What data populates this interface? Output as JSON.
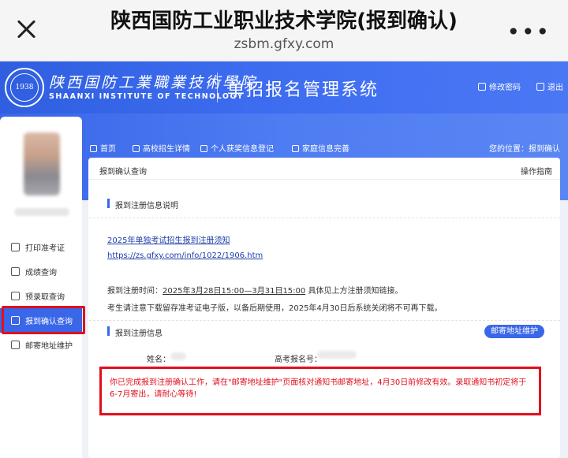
{
  "browser": {
    "title": "陕西国防工业职业技术学院(报到确认)",
    "url": "zsbm.gfxy.com"
  },
  "header": {
    "school_cn": "陕西国防工業職業技術學院",
    "school_en": "SHAANXI INSTITUTE OF TECHNOLOGY",
    "system_name": "单招报名管理系统",
    "change_password": "修改密码",
    "logout": "退出"
  },
  "sidebar": {
    "items": [
      {
        "label": "打印准考证",
        "icon": "printer-icon"
      },
      {
        "label": "成绩查询",
        "icon": "score-icon"
      },
      {
        "label": "预录取查询",
        "icon": "admission-icon"
      },
      {
        "label": "报到确认查询",
        "icon": "confirm-icon"
      },
      {
        "label": "邮寄地址维护",
        "icon": "address-icon"
      }
    ],
    "active_index": 3
  },
  "nav": {
    "items": [
      {
        "label": "首页",
        "icon": "home-icon"
      },
      {
        "label": "高校招生详情",
        "icon": "book-icon"
      },
      {
        "label": "个人获奖信息登记",
        "icon": "user-icon"
      },
      {
        "label": "家庭信息完善",
        "icon": "family-icon"
      }
    ],
    "location_label": "您的位置：报到确认"
  },
  "main": {
    "breadcrumb": "报到确认查询",
    "guide": "操作指南",
    "section1_title": "报到注册信息说明",
    "notice_link": "2025年单独考试招生报到注册须知",
    "notice_url": "https://zs.gfxy.com/info/1022/1906.htm",
    "reg_time_prefix": "报到注册时间：",
    "reg_time": "2025年3月28日15:00—3月31日15:00",
    "reg_time_suffix": " 具体见上方注册须知链接。",
    "download_tip": "考生请注意下载留存准考证电子版，以备后期使用，2025年4月30日后系统关闭将不可再下载。",
    "section2_title": "报到注册信息",
    "mail_button": "邮寄地址维护",
    "name_label": "姓名：",
    "exam_no_label": "高考报名号：",
    "notice_text": "你已完成报到注册确认工作，请在\"邮寄地址维护\"页面核对通知书邮寄地址，4月30日前修改有效。录取通知书初定将于6-7月寄出，请耐心等待!"
  },
  "colors": {
    "primary": "#3a66e8",
    "alert_red": "#e0101e"
  }
}
